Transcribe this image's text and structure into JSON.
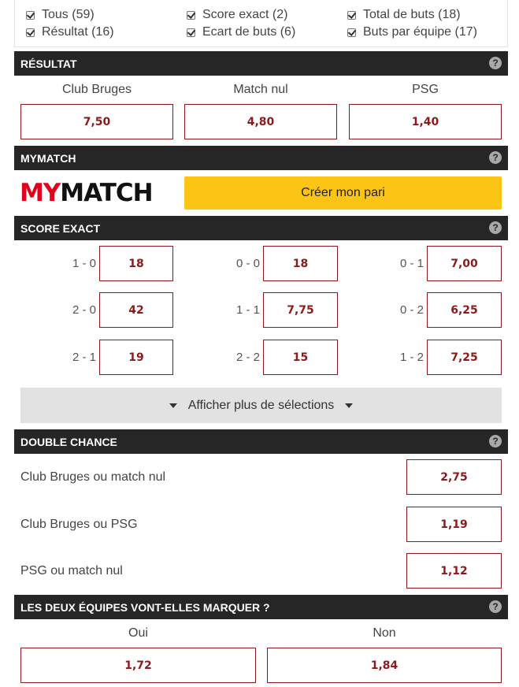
{
  "filters": [
    {
      "label": "Tous (59)",
      "checked": true
    },
    {
      "label": "Résultat (16)",
      "checked": true
    },
    {
      "label": "Score exact (2)",
      "checked": true
    },
    {
      "label": "Ecart de buts (6)",
      "checked": true
    },
    {
      "label": "Total de buts (18)",
      "checked": true
    },
    {
      "label": "Buts par équipe (17)",
      "checked": true
    }
  ],
  "help_glyph": "?",
  "resultat": {
    "title": "RÉSULTAT",
    "options": [
      {
        "label": "Club Bruges",
        "odd": "7,50"
      },
      {
        "label": "Match nul",
        "odd": "4,80"
      },
      {
        "label": "PSG",
        "odd": "1,40"
      }
    ]
  },
  "mymatch": {
    "title": "MYMATCH",
    "logo_my": "MY",
    "logo_match": "MATCH",
    "button": "Créer mon pari"
  },
  "score_exact": {
    "title": "SCORE EXACT",
    "rows": [
      [
        {
          "score": "1 - 0",
          "odd": "18"
        },
        {
          "score": "0 - 0",
          "odd": "18"
        },
        {
          "score": "0 - 1",
          "odd": "7,00"
        }
      ],
      [
        {
          "score": "2 - 0",
          "odd": "42"
        },
        {
          "score": "1 - 1",
          "odd": "7,75"
        },
        {
          "score": "0 - 2",
          "odd": "6,25"
        }
      ],
      [
        {
          "score": "2 - 1",
          "odd": "19"
        },
        {
          "score": "2 - 2",
          "odd": "15"
        },
        {
          "score": "1 - 2",
          "odd": "7,25"
        }
      ]
    ],
    "more_label": "Afficher plus de sélections"
  },
  "double_chance": {
    "title": "DOUBLE CHANCE",
    "options": [
      {
        "label": "Club Bruges ou match nul",
        "odd": "2,75"
      },
      {
        "label": "Club Bruges ou PSG",
        "odd": "1,19"
      },
      {
        "label": "PSG ou match nul",
        "odd": "1,12"
      }
    ]
  },
  "btts": {
    "title": "LES DEUX ÉQUIPES VONT-ELLES MARQUER ?",
    "options": [
      {
        "label": "Oui",
        "odd": "1,72"
      },
      {
        "label": "Non",
        "odd": "1,84"
      }
    ]
  },
  "colors": {
    "header_bg": "#262626",
    "odd_color": "#8b1a1a",
    "button_yellow": "#fcc415",
    "logo_red": "#e3001b"
  }
}
